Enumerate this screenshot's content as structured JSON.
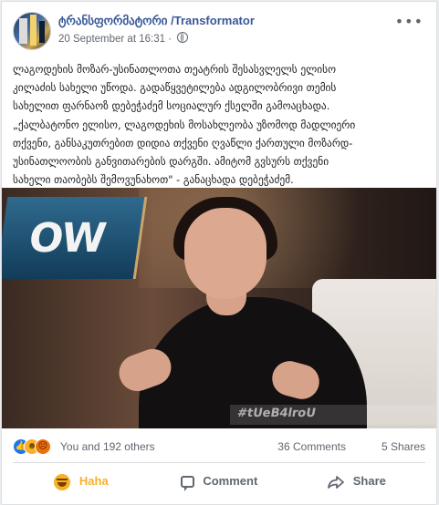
{
  "post": {
    "page_name": "ტრანსფორმატორი /Transformator",
    "timestamp": "20 September at 16:31",
    "audience_icon": "globe-icon",
    "more_icon": "ellipsis-icon",
    "more_label": "•••",
    "text": "ლაგოდეხის მოზარ-უსინათლოთა თეატრის შესასვლელს ელისო\nკილაძის სახელი უწოდა. გადაწყვეტილება ადგილობრივი თემის\nსახელით ფარნაოზ დებეჭაძემ სოციალურ ქსელში გამოაცხადა.\n„ქალბატონო ელისო, ლაგოდეხის მოსახლეობა უზომოდ მადლიერი\nთქვენი, განსაკუთრებით დიდია თქვენი ღვაწლი ქართული მოზარდ-\nუსინათლოობის განვითარების დარგში. ამიტომ გვსურს თქვენი\nსახელი თაობებს შემოვუნახოთ\" - განაცხადა დებეჭაძემ.",
    "image": {
      "show_sign_text": "OW",
      "ticker_text": "#tUeB4lroU"
    }
  },
  "reactions": {
    "icons": [
      "like-icon",
      "haha-icon",
      "angry-icon"
    ],
    "count_text": "You and 192 others",
    "comments_text": "36 Comments",
    "shares_text": "5 Shares"
  },
  "actions": {
    "haha_label": "Haha",
    "comment_label": "Comment",
    "share_label": "Share"
  },
  "colors": {
    "link_blue": "#385898",
    "haha_yellow": "#f7b125",
    "like_blue": "#1877f2",
    "angry_orange": "#e9710f",
    "secondary_text": "#606770"
  }
}
